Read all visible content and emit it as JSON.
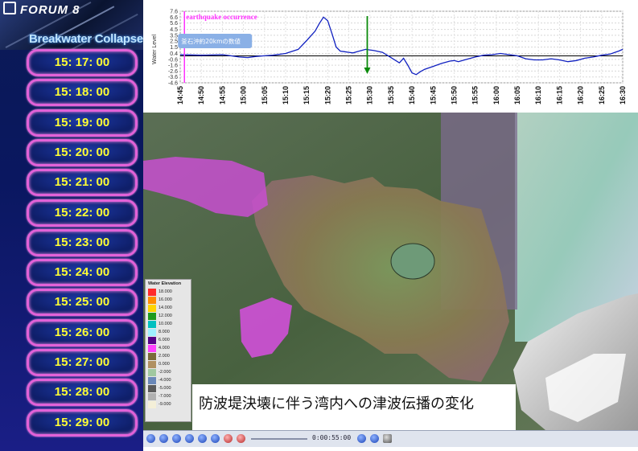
{
  "brand": {
    "name": "FORUM 8"
  },
  "panel": {
    "title": "Breakwater Collapse"
  },
  "time_buttons": [
    "15: 17: 00",
    "15: 18: 00",
    "15: 19: 00",
    "15: 20: 00",
    "15: 21: 00",
    "15: 22: 00",
    "15: 23: 00",
    "15: 24: 00",
    "15: 25: 00",
    "15: 26: 00",
    "15: 27: 00",
    "15: 28: 00",
    "15: 29: 00"
  ],
  "chart_data": {
    "type": "line",
    "ylabel": "Water Level",
    "annotation": "earthquake occurrence",
    "label_box": "釜石沖約20kmの数値",
    "x_ticks": [
      "14:45",
      "14:50",
      "14:55",
      "15:00",
      "15:05",
      "15:10",
      "15:15",
      "15:20",
      "15:25",
      "15:30",
      "15:35",
      "15:40",
      "15:45",
      "15:50",
      "15:55",
      "16:00",
      "16:05",
      "16:10",
      "16:15",
      "16:20",
      "16:25",
      "16:30"
    ],
    "y_ticks": [
      "7.6",
      "6.6",
      "5.6",
      "4.5",
      "3.5",
      "2.5",
      "1.5",
      "0.4",
      "-0.6",
      "-1.6",
      "-2.6",
      "-3.6",
      "-4.6"
    ],
    "ylim": [
      -4.6,
      7.6
    ],
    "xlim_minutes": [
      0,
      105
    ],
    "baseline": 0,
    "earthquake_time": "14:46",
    "current_time": "15:29",
    "series": [
      {
        "x_minutes": [
          0,
          5,
          10,
          12,
          14,
          16,
          18,
          20,
          22,
          25,
          28,
          30,
          32,
          33,
          34,
          35,
          36,
          37,
          38,
          39,
          40,
          41,
          42,
          44,
          46,
          48,
          50,
          52,
          53,
          54,
          55,
          56,
          57,
          58,
          60,
          62,
          64,
          65,
          66,
          68,
          70,
          72,
          74,
          76,
          78,
          80,
          82,
          84,
          86,
          88,
          90,
          92,
          94,
          96,
          98,
          100,
          102,
          104,
          105
        ],
        "values": [
          0.2,
          0.1,
          0.2,
          0.0,
          -0.2,
          -0.3,
          -0.1,
          0.0,
          0.1,
          0.4,
          1.1,
          2.6,
          4.2,
          5.5,
          6.6,
          6.0,
          3.8,
          1.5,
          0.8,
          0.7,
          0.6,
          0.5,
          0.7,
          1.1,
          0.9,
          0.6,
          -0.3,
          -1.2,
          -0.4,
          -1.6,
          -2.9,
          -3.2,
          -2.7,
          -2.3,
          -1.8,
          -1.3,
          -0.9,
          -0.8,
          -1.0,
          -0.6,
          -0.2,
          0.1,
          0.2,
          0.4,
          0.2,
          0.0,
          -0.5,
          -0.7,
          -0.7,
          -0.5,
          -0.7,
          -1.0,
          -0.8,
          -0.4,
          -0.2,
          0.1,
          0.3,
          0.8,
          1.1
        ]
      }
    ]
  },
  "legend": {
    "title": "Water Elevation",
    "items": [
      {
        "label": "18.000",
        "color": "#ff2a2a"
      },
      {
        "label": "16.000",
        "color": "#ff8c00"
      },
      {
        "label": "14.000",
        "color": "#ffd400"
      },
      {
        "label": "12.000",
        "color": "#1e9b1e"
      },
      {
        "label": "10.000",
        "color": "#00c0c0"
      },
      {
        "label": "8.000",
        "color": "#9ff0ff"
      },
      {
        "label": "6.000",
        "color": "#550088"
      },
      {
        "label": "4.000",
        "color": "#ff40ff"
      },
      {
        "label": "2.000",
        "color": "#7a6a3a"
      },
      {
        "label": "0.000",
        "color": "#b09060"
      },
      {
        "label": "-2.000",
        "color": "#a0c8a0"
      },
      {
        "label": "-4.000",
        "color": "#6a88b8"
      },
      {
        "label": "-5.000",
        "color": "#5a5a5a"
      },
      {
        "label": "-7.000",
        "color": "#b0b0b0"
      },
      {
        "label": "-9.000",
        "color": "#f4efd8"
      }
    ]
  },
  "caption": "防波堤決壊に伴う湾内への津波伝播の変化",
  "player": {
    "time": "0:00:55:00"
  },
  "colors": {
    "accent_pink": "#e262d8",
    "button_text": "#ffff33",
    "current_marker": "#0a8a0a",
    "quake_marker": "#ff33ff",
    "series": "#1020c0"
  }
}
